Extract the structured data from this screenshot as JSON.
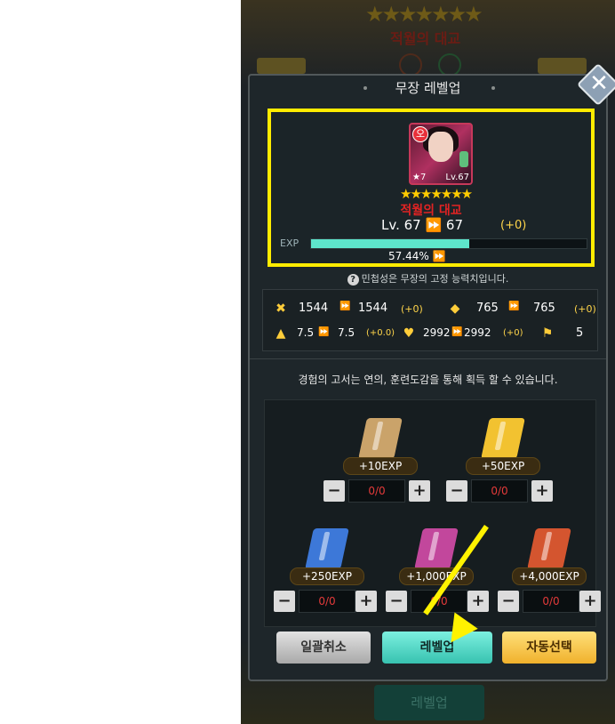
{
  "background": {
    "stars": "★★★★★★★",
    "hero_name": "적월의 대교",
    "bottom_button": "레벨업"
  },
  "dialog": {
    "title": "무장 레벨업",
    "close_icon": "close-icon"
  },
  "hero": {
    "badge": "오",
    "card_stars": "★7",
    "card_level": "Lv.67",
    "stars": "★★★★★★★",
    "name": "적월의 대교",
    "level_text": "Lv.  67  ⏩  67",
    "level_plus": "(+0)",
    "exp_label": "EXP",
    "exp_percent": 57.44,
    "exp_percent_text": "57.44%  ⏩"
  },
  "info_text": "민첩성은 무장의 고정 능력치입니다.",
  "stats": [
    {
      "icon": "attack-icon",
      "from": "1544",
      "to": "1544",
      "plus": "(+0)"
    },
    {
      "icon": "defense-icon",
      "from": "765",
      "to": "765",
      "plus": "(+0)"
    },
    {
      "icon": "speed-icon",
      "from": "7.5",
      "to": "7.5",
      "plus": "(+0.0)"
    },
    {
      "icon": "health-icon",
      "from": "2992",
      "to": "2992",
      "plus": "(+0)"
    },
    {
      "icon": "agility-icon",
      "value": "5"
    }
  ],
  "guide_text": "경험의 고서는 연의, 훈련도감을 통해 획득 할 수 있습니다.",
  "books": [
    {
      "exp": "+10EXP",
      "count": "0/0",
      "color": "#caa36a"
    },
    {
      "exp": "+50EXP",
      "count": "0/0",
      "color": "#f2c230"
    },
    {
      "exp": "+250EXP",
      "count": "0/0",
      "color": "#3d78d8"
    },
    {
      "exp": "+1,000EXP",
      "count": "0/0",
      "color": "#c2479c"
    },
    {
      "exp": "+4,000EXP",
      "count": "0/0",
      "color": "#d4552f"
    }
  ],
  "buttons": {
    "cancel_all": "일괄취소",
    "level_up": "레벨업",
    "auto_select": "자동선택"
  },
  "colors": {
    "highlight": "#ffec00",
    "exp_fill": "#5ee6cc",
    "accent_gold": "#ffd54a"
  }
}
